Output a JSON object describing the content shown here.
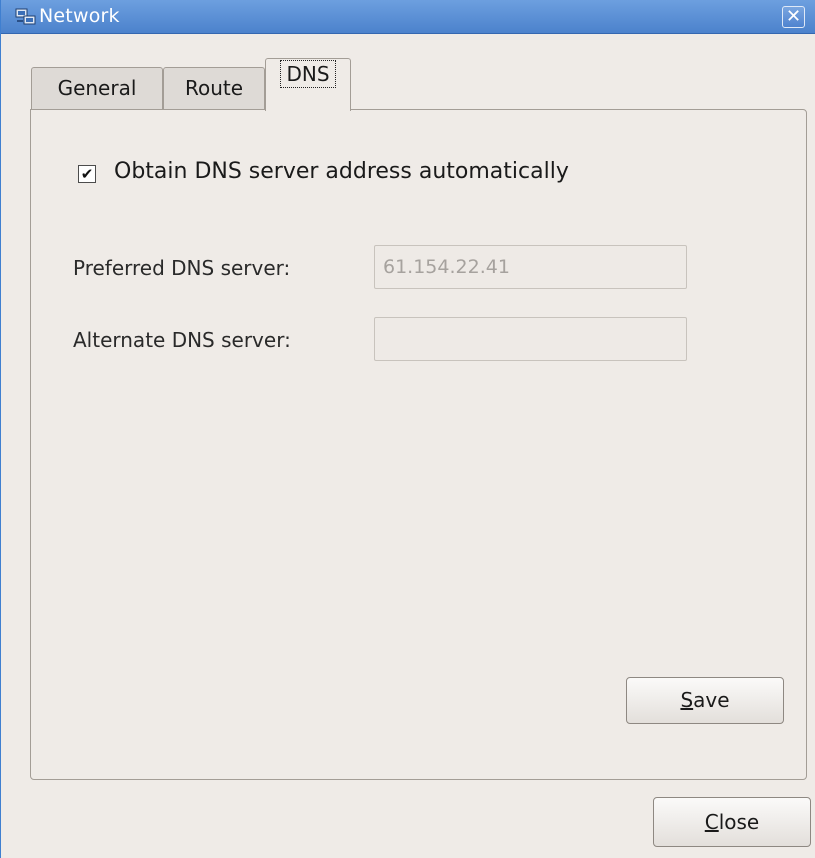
{
  "window": {
    "title": "Network",
    "close_glyph": "✕",
    "title_icon": "network-icon"
  },
  "tabs": [
    {
      "label": "General",
      "selected": false
    },
    {
      "label": "Route",
      "selected": false
    },
    {
      "label": "DNS",
      "selected": true
    }
  ],
  "dns": {
    "auto_checkbox": {
      "label": "Obtain DNS server address automatically",
      "checked": true,
      "glyph": "✔"
    },
    "preferred": {
      "label": "Preferred DNS server:",
      "value": "61.154.22.41"
    },
    "alternate": {
      "label": "Alternate DNS server:",
      "value": ""
    },
    "save_mnemonic": "S",
    "save_rest": "ave"
  },
  "footer": {
    "close_mnemonic": "C",
    "close_rest": "lose"
  },
  "colors": {
    "titlebar": "#4c82cc",
    "background": "#efebe7",
    "disabled_text": "#a6a29e"
  }
}
